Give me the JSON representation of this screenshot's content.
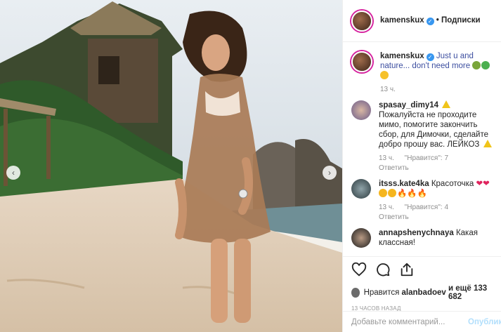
{
  "post": {
    "author": "kamenskux",
    "follow_label": "• Подписки",
    "caption_text": "Just u and nature... don't need more"
  },
  "comments": [
    {
      "user": "spasay_dimy14",
      "text_a": "Пожалуйста не проходите мимо, помогите закончить сбор, для Димочки, сделайте добро прошу вас. ЛЕЙКОЗ",
      "time": "13 ч.",
      "likes": "\"Нравится\": 7",
      "reply": "Ответить"
    },
    {
      "user": "itsss.kate4ka",
      "text_a": "Красоточка",
      "time": "13 ч.",
      "likes": "\"Нравится\": 4",
      "reply": "Ответить"
    },
    {
      "user": "annapshenychnaya",
      "text_a": "Какая классная!"
    }
  ],
  "caption_time": "13 ч.",
  "likes": {
    "prefix": "Нравится",
    "user": "alanbadoev",
    "suffix": "и ещё 133 682"
  },
  "timestamp": "13 ЧАСОВ НАЗАД",
  "add_comment": {
    "placeholder": "Добавьте комментарий...",
    "post_label": "Опубликовать"
  },
  "icons": [
    "heart-icon",
    "comment-icon",
    "share-icon",
    "chevron-left-icon",
    "chevron-right-icon",
    "verified-icon",
    "warning-icon"
  ]
}
